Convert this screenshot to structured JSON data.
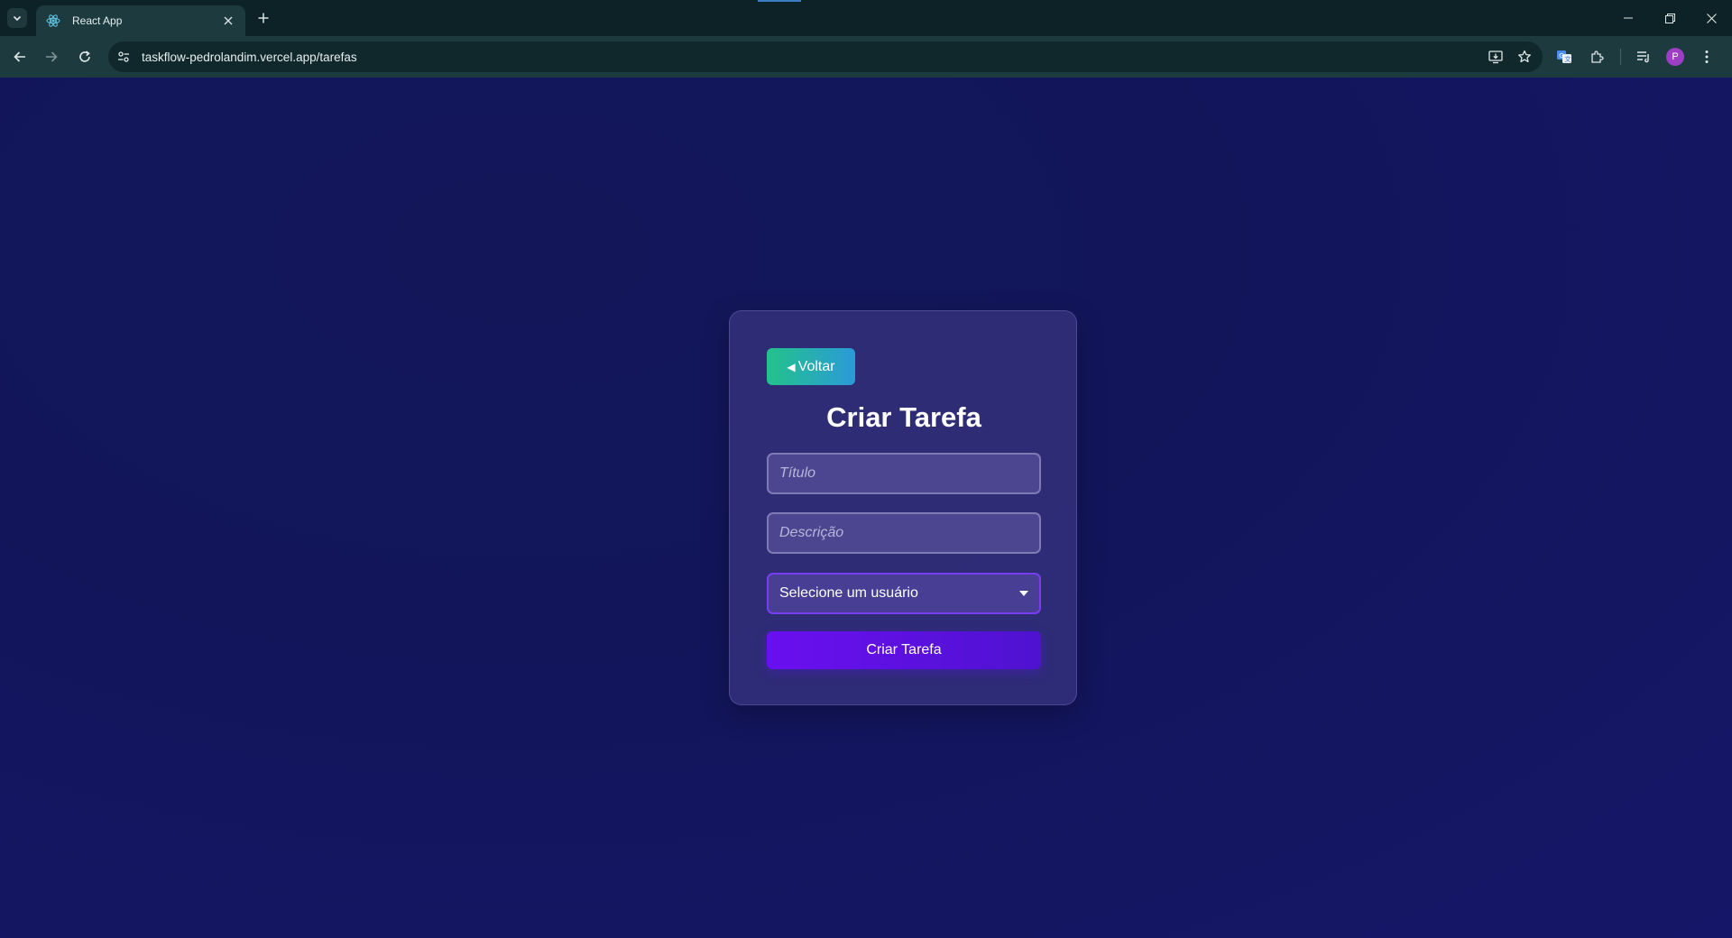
{
  "browser": {
    "tab_title": "React App",
    "url": "taskflow-pedrolandim.vercel.app/tarefas",
    "avatar_letter": "P"
  },
  "page": {
    "back_button_label": "Voltar",
    "title": "Criar Tarefa",
    "title_placeholder": "Título",
    "description_placeholder": "Descrição",
    "user_select_value": "Selecione um usuário",
    "submit_button_label": "Criar Tarefa"
  },
  "colors": {
    "background": "#12155a",
    "accent_purple": "#6a0ff0",
    "back_button_green": "#23c28a",
    "back_button_blue": "#2b9ad8"
  }
}
